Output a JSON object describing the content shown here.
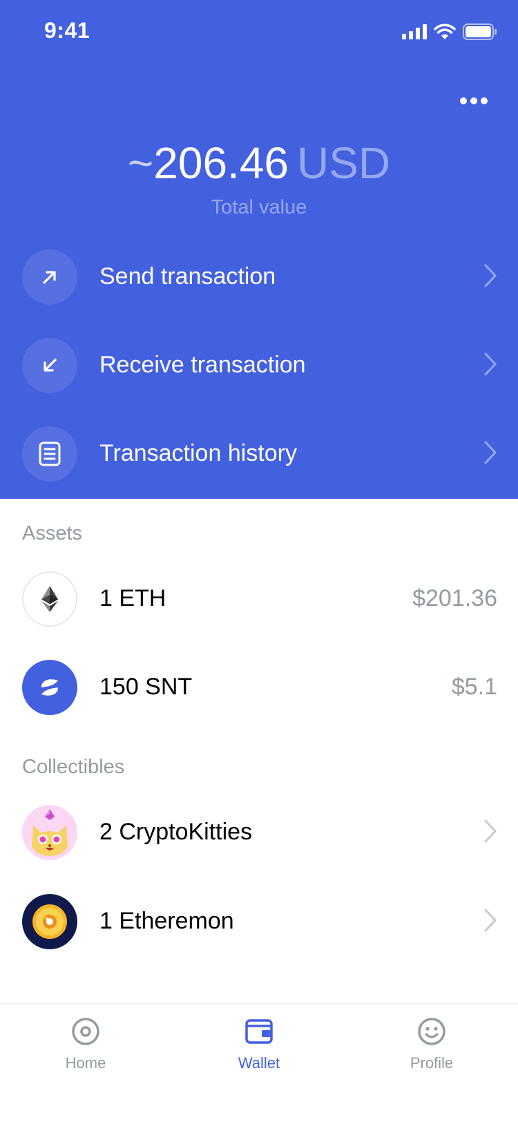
{
  "status_bar": {
    "time": "9:41"
  },
  "header": {
    "balance": {
      "prefix": "~",
      "amount": "206.46",
      "currency": "USD",
      "label": "Total value"
    },
    "actions": [
      {
        "label": "Send transaction",
        "icon": "arrow-up-right-icon"
      },
      {
        "label": "Receive transaction",
        "icon": "arrow-down-left-icon"
      },
      {
        "label": "Transaction history",
        "icon": "document-icon"
      }
    ]
  },
  "assets": {
    "title": "Assets",
    "items": [
      {
        "name": "1 ETH",
        "value": "$201.36",
        "icon": "ethereum-icon"
      },
      {
        "name": "150 SNT",
        "value": "$5.1",
        "icon": "status-snt-icon"
      }
    ]
  },
  "collectibles": {
    "title": "Collectibles",
    "items": [
      {
        "name": "2 CryptoKitties",
        "icon": "cryptokitty-icon"
      },
      {
        "name": "1 Etheremon",
        "icon": "etheremon-icon"
      }
    ]
  },
  "tabs": [
    {
      "label": "Home",
      "icon": "home-icon",
      "active": false
    },
    {
      "label": "Wallet",
      "icon": "wallet-icon",
      "active": true
    },
    {
      "label": "Profile",
      "icon": "profile-icon",
      "active": false
    }
  ],
  "colors": {
    "accent": "#4360df",
    "muted": "#939ba1",
    "background": "#ffffff"
  }
}
